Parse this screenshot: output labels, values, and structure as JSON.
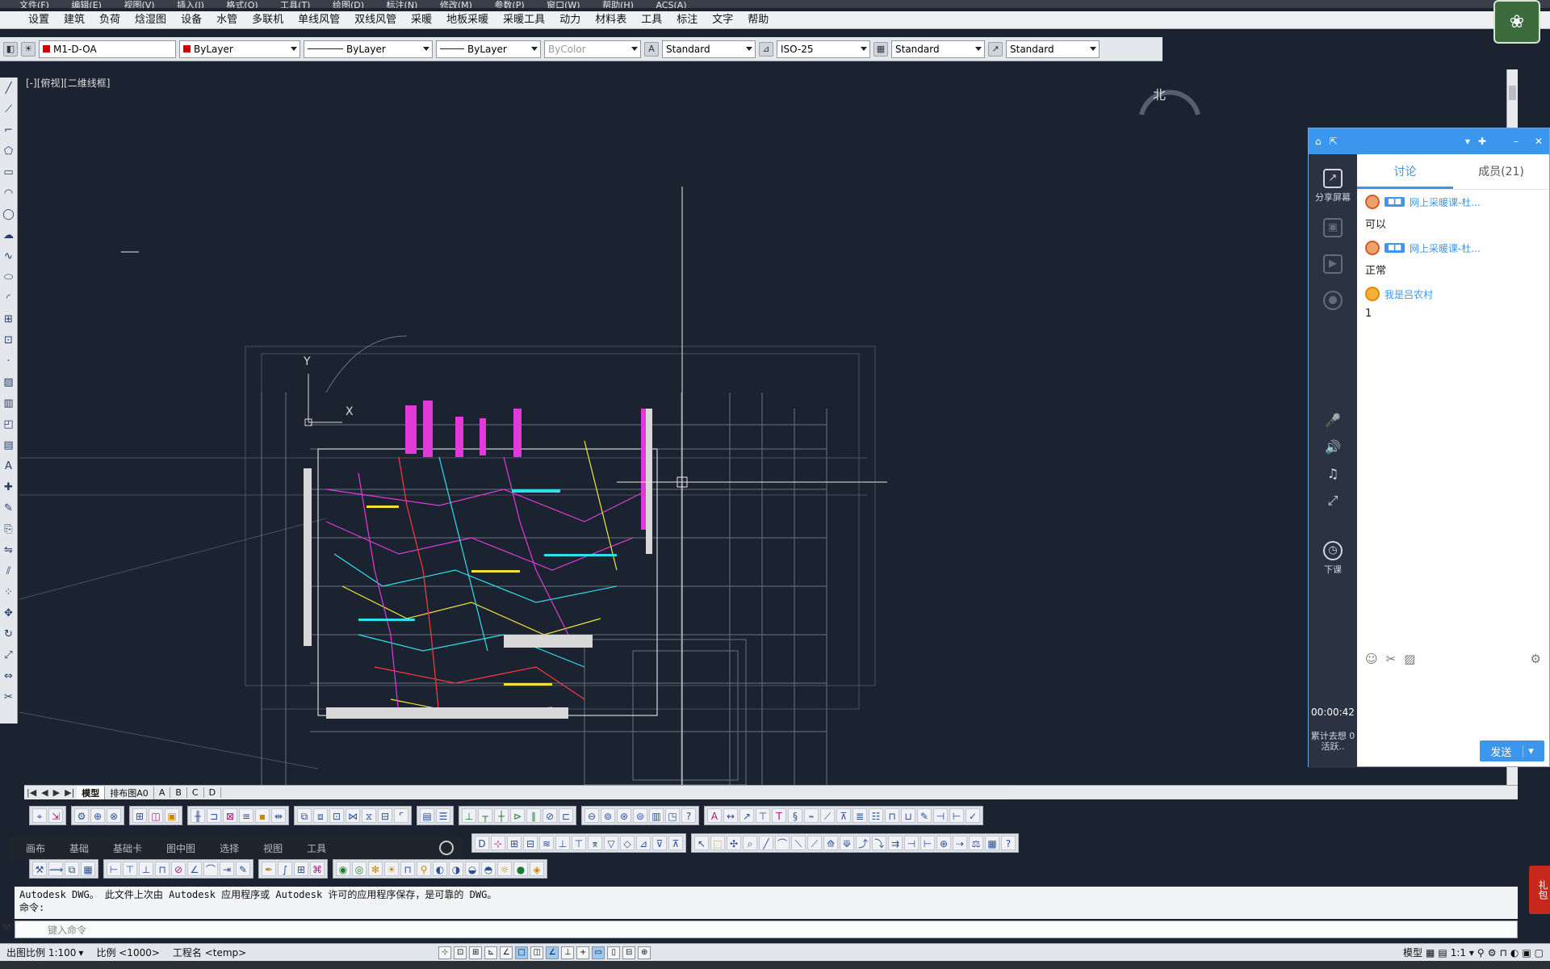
{
  "menus": {
    "top": [
      "文件(F)",
      "编辑(E)",
      "视图(V)",
      "插入(I)",
      "格式(O)",
      "工具(T)",
      "绘图(D)",
      "标注(N)",
      "修改(M)",
      "参数(P)",
      "窗口(W)",
      "帮助(H)",
      "ACS(A)"
    ],
    "main": [
      "设置",
      "建筑",
      "负荷",
      "焓湿图",
      "设备",
      "水管",
      "多联机",
      "单线风管",
      "双线风管",
      "采暖",
      "地板采暖",
      "采暖工具",
      "动力",
      "材料表",
      "工具",
      "标注",
      "文字",
      "帮助"
    ]
  },
  "props": {
    "layer": "M1-D-OA",
    "color": "ByLayer",
    "linetype": "ByLayer",
    "lineweight": "ByLayer",
    "plotstyle": "ByColor",
    "text_style": "Standard",
    "dim_style": "ISO-25",
    "table_style": "Standard",
    "mleader_style": "Standard"
  },
  "canvas": {
    "viewport_label": "[-][俯视][二维线框]",
    "ucs_y": "Y",
    "ucs_x": "X",
    "compass": "北"
  },
  "tabs": {
    "model": "模型",
    "layouts": [
      "排布图A0",
      "A",
      "B",
      "C",
      "D"
    ]
  },
  "plugin": [
    "画布",
    "基础",
    "基础卡",
    "图中图",
    "选择",
    "视图",
    "工具"
  ],
  "command": {
    "line1": "Autodesk DWG。  此文件上次由 Autodesk 应用程序或 Autodesk 许可的应用程序保存，是可靠的 DWG。",
    "line2": "命令:",
    "placeholder": "键入命令"
  },
  "status": {
    "plot_scale": "出图比例 1:100",
    "scale": "比例 <1000>",
    "project": "工程名 <temp>",
    "model": "模型",
    "anno_scale": "1:1"
  },
  "banner": "礼包",
  "chat": {
    "tabs": [
      "讨论",
      "成员(21)"
    ],
    "messages": [
      {
        "sender": "网上采暖课-杜...",
        "text": "可以"
      },
      {
        "sender": "网上采暖课-杜...",
        "text": "正常"
      },
      {
        "sender": "我是吕农村",
        "text": "1"
      }
    ],
    "side": [
      "分享屏幕",
      "下课"
    ],
    "timer": "00:00:42",
    "timer_sub": "累计去想 0 活跃..",
    "send": "发送"
  }
}
